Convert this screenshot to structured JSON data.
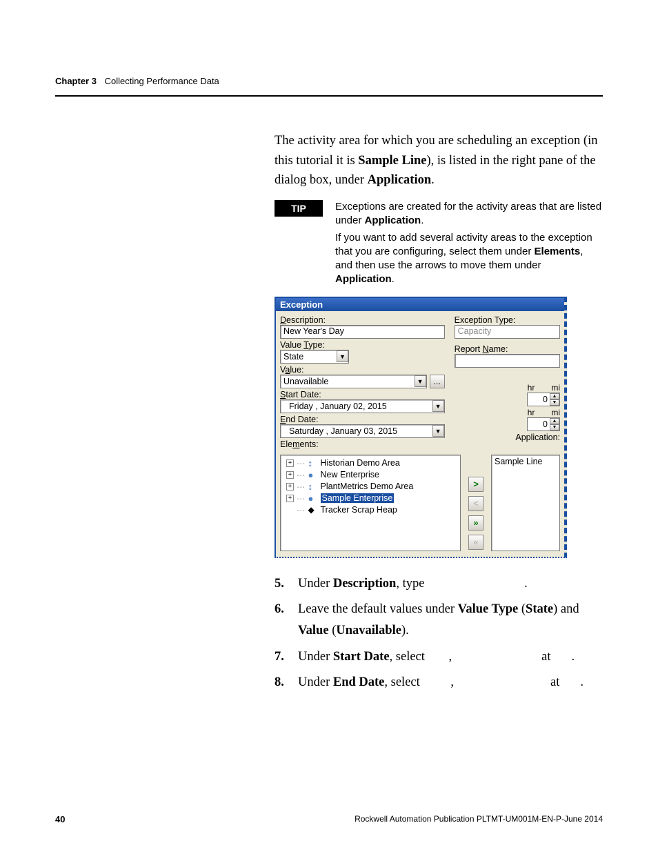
{
  "header": {
    "chapter": "Chapter 3",
    "title": "Collecting Performance Data"
  },
  "intro": {
    "pre": "The activity area for which you are scheduling an exception (in this tutorial it is ",
    "bold1": "Sample Line",
    "mid": "), is listed in the right pane of the dialog box, under ",
    "bold2": "Application",
    "post": "."
  },
  "tip": {
    "label": "TIP",
    "p1a": "Exceptions are created for the activity areas that are listed under ",
    "p1b": "Application",
    "p1c": ".",
    "p2a": "If you want to add several activity areas to the exception that you are configuring, select them under ",
    "p2b": "Elements",
    "p2c": ", and then use the arrows to move them under ",
    "p2d": "Application",
    "p2e": "."
  },
  "dialog": {
    "title": "Exception",
    "description_label_pre": "D",
    "description_label_post": "escription:",
    "description_value": "New Year's Day",
    "value_type_label_pre": "Value ",
    "value_type_label_u": "T",
    "value_type_label_post": "ype:",
    "value_type_value": "State",
    "value_label_pre": "V",
    "value_label_u": "a",
    "value_label_post": "lue:",
    "value_value": "Unavailable",
    "start_date_label_pre": "S",
    "start_date_label_post": "tart Date:",
    "start_date_value": "Friday   ,  January  02, 2015",
    "end_date_label_pre": "E",
    "end_date_label_post": "nd Date:",
    "end_date_value": "Saturday ,  January  03, 2015",
    "elements_label_pre": "Ele",
    "elements_label_u": "m",
    "elements_label_post": "ents:",
    "exception_type_label": "Exception Type:",
    "exception_type_value": "Capacity",
    "report_name_label_pre": "Report ",
    "report_name_u": "N",
    "report_name_post": "ame:",
    "report_name_value": "",
    "hr_label": "hr",
    "mi_label": "mi",
    "spin1": "0",
    "spin2": "0",
    "application_label": "Application:",
    "application_value": "Sample Line",
    "tree": [
      {
        "exp": "+",
        "icon": "arrows",
        "text": "Historian Demo Area",
        "sel": false
      },
      {
        "exp": "+",
        "icon": "globe",
        "text": "New Enterprise",
        "sel": false
      },
      {
        "exp": "+",
        "icon": "arrows",
        "text": "PlantMetrics Demo Area",
        "sel": false
      },
      {
        "exp": "+",
        "icon": "globe2",
        "text": "Sample Enterprise",
        "sel": true
      },
      {
        "exp": "",
        "icon": "recycle",
        "text": "Tracker Scrap Heap",
        "sel": false
      }
    ],
    "move_right": ">",
    "move_left": "<",
    "move_right_all": "»",
    "move_left_all": "«"
  },
  "steps": {
    "s5": {
      "a": "Under ",
      "b1": "Description",
      "b": ", type ",
      "c": "."
    },
    "s6": {
      "a": "Leave the default values under ",
      "b1": "Value Type",
      "b2": " (",
      "b3": "State",
      "b4": ") and ",
      "b5": "Value",
      "b6": " (",
      "b7": "Unavailable",
      "b8": ")."
    },
    "s7": {
      "a": "Under ",
      "b1": "Start Date",
      "b": ", select ",
      "c": ",",
      "d": "at",
      "e": "."
    },
    "s8": {
      "a": "Under ",
      "b1": "End Date",
      "b": ", select ",
      "c": ",",
      "d": "at",
      "e": "."
    }
  },
  "footer": {
    "page": "40",
    "pub": "Rockwell Automation Publication PLTMT-UM001M-EN-P-June 2014"
  }
}
